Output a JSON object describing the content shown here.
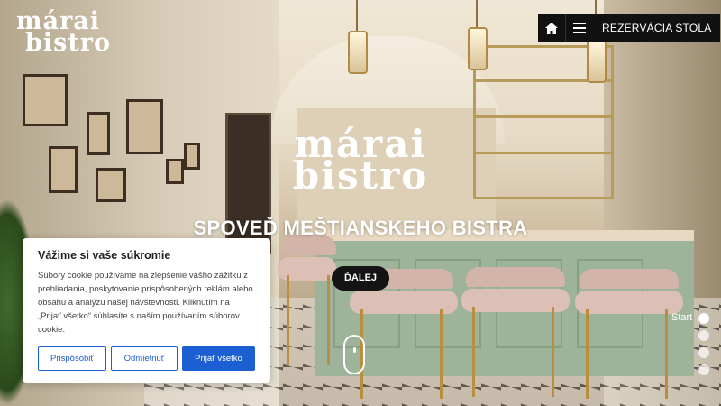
{
  "header": {
    "logo_line1": "márai",
    "logo_line2": "bistro",
    "nav_home_icon": "home-icon",
    "nav_menu_icon": "hamburger-menu-icon",
    "reservation_label": "REZERVÁCIA STOLA"
  },
  "hero": {
    "logo_line1": "márai",
    "logo_line2": "bistro",
    "headline": "SPOVEĎ MEŠTIANSKEHO BISTRA",
    "next_label": "ĎALEJ"
  },
  "slider": {
    "label": "Start",
    "dots": 4,
    "active_index": 0
  },
  "cookie_banner": {
    "title": "Vážime si vaše súkromie",
    "body": "Súbory cookie používame na zlepšenie vášho zážitku z prehliadania, poskytovanie prispôsobených reklám alebo obsahu a analýzu našej návštevnosti. Kliknutím na „Prijať všetko“ súhlasíte s naším používaním súborov cookie.",
    "customize_label": "Prispôsobiť",
    "reject_label": "Odmietnuť",
    "accept_label": "Prijať všetko"
  },
  "colors": {
    "accent": "#1c5fd2",
    "nav_bg": "#111111"
  }
}
